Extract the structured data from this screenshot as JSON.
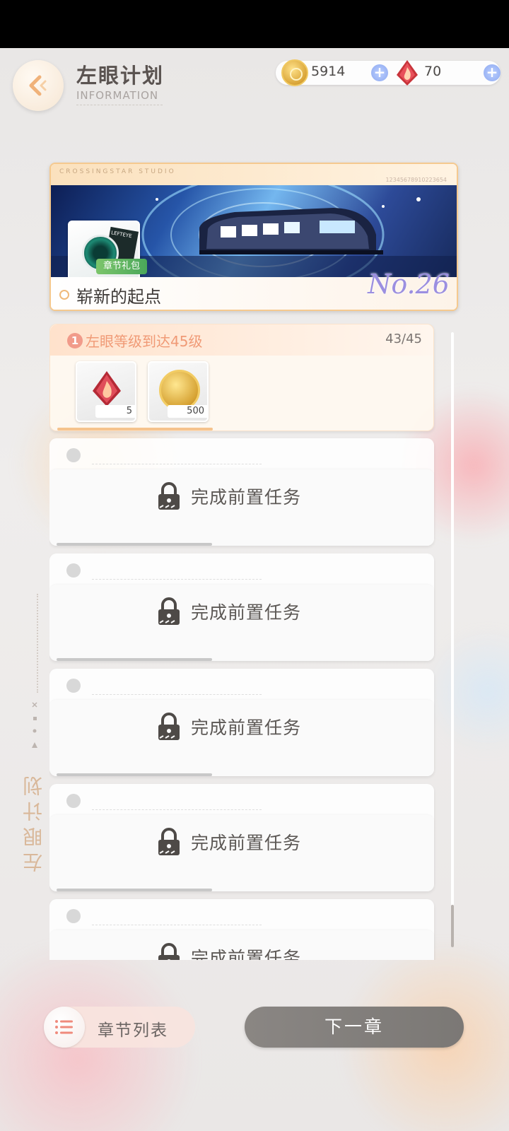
{
  "header": {
    "title": "左眼计划",
    "subtitle": "INFORMATION"
  },
  "currencies": {
    "coins": "5914",
    "gems": "70"
  },
  "banner": {
    "studio": "CROSSINGSTAR STUDIO",
    "serial": "12345678910223654",
    "gift_card_tag": "LEFTEYE",
    "gift_label": "章节礼包",
    "chapter_name": "崭新的起点",
    "chapter_number": "No.26"
  },
  "tasks": [
    {
      "index": "1",
      "title": "左眼等级到达45级",
      "progress": "43/45",
      "rewards": [
        {
          "icon": "flame-gem-icon",
          "qty": "5"
        },
        {
          "icon": "gold-coin-icon",
          "qty": "500"
        }
      ]
    },
    {
      "locked_text": "完成前置任务"
    },
    {
      "locked_text": "完成前置任务"
    },
    {
      "locked_text": "完成前置任务"
    },
    {
      "locked_text": "完成前置任务"
    },
    {
      "locked_text": "完成前置任务"
    }
  ],
  "side_label": "左眼计划",
  "footer": {
    "chapter_list_label": "章节列表",
    "next_chapter_label": "下一章"
  },
  "colors": {
    "accent_orange": "#f09a76",
    "next_button": "#858280",
    "plus_blue": "#8da8f0"
  }
}
